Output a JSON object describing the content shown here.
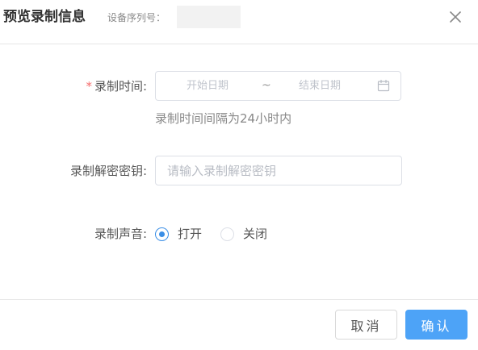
{
  "header": {
    "title": "预览录制信息",
    "serial_label": "设备序列号：",
    "serial_value": "",
    "close_icon": "close-icon"
  },
  "form": {
    "time": {
      "required_mark": "*",
      "label": "录制时间:",
      "start_placeholder": "开始日期",
      "separator": "~",
      "end_placeholder": "结束日期",
      "icon": "calendar-icon",
      "hint": "录制时间间隔为24小时内"
    },
    "password": {
      "label": "录制解密密钥:",
      "placeholder": "请输入录制解密密钥",
      "value": ""
    },
    "sound": {
      "label": "录制声音:",
      "options": [
        {
          "label": "打开",
          "checked": true
        },
        {
          "label": "关闭",
          "checked": false
        }
      ]
    }
  },
  "footer": {
    "cancel_label": "取消",
    "confirm_label": "确认"
  },
  "colors": {
    "primary": "#4da3f7",
    "radio_checked": "#3a8ee6",
    "required": "#f56c6c",
    "border": "#dcdfe6",
    "divider": "#e6e6e6"
  }
}
